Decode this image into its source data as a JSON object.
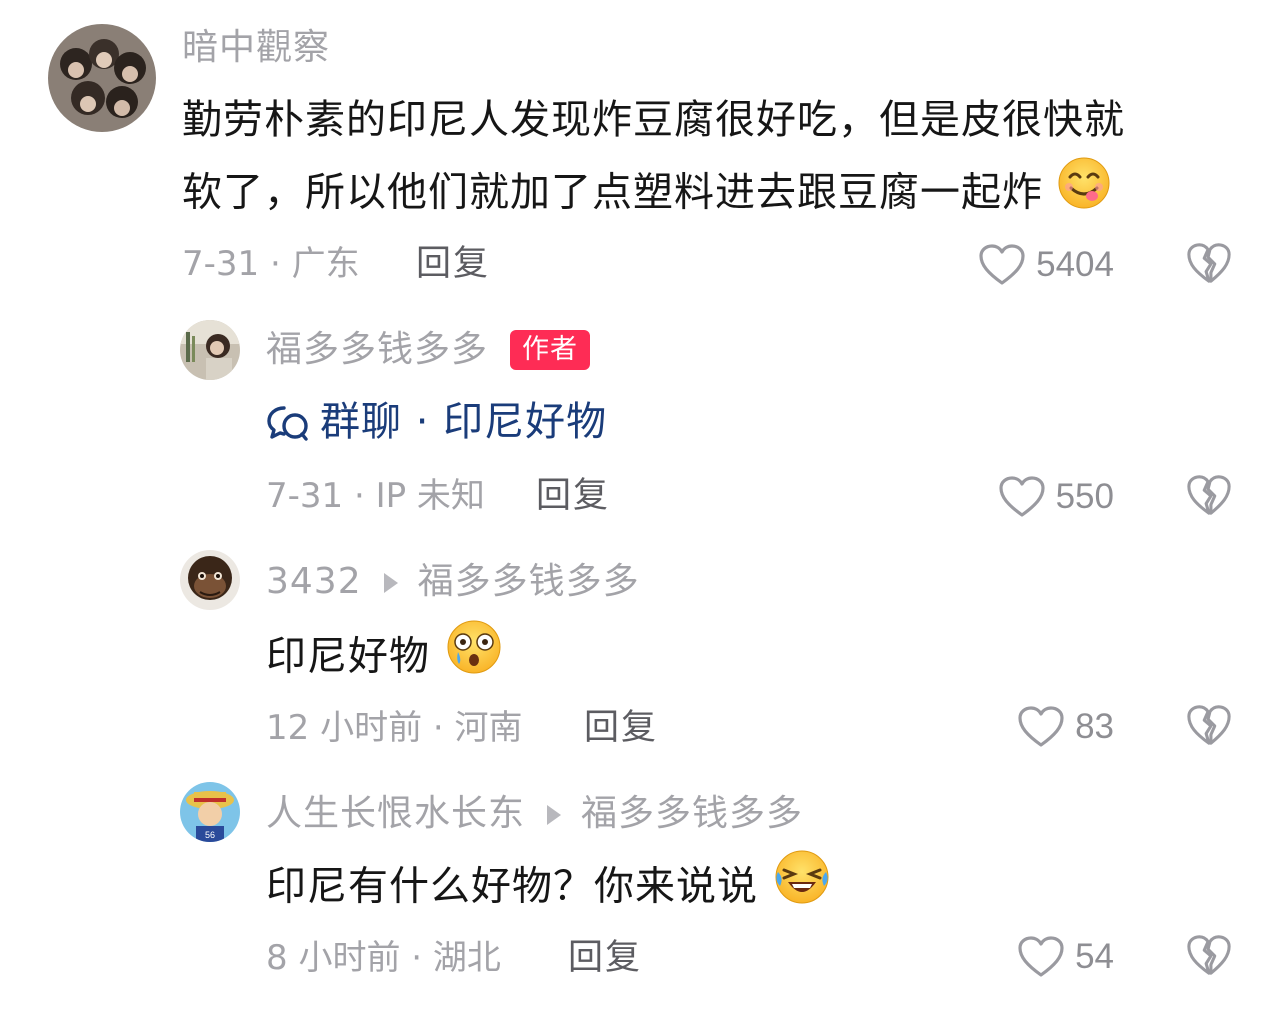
{
  "comments": [
    {
      "username": "暗中觀察",
      "text_line1": "勤劳朴素的印尼人发现炸豆腐很好吃，但是皮很快就",
      "text_line2": "软了，所以他们就加了点塑料进去跟豆腐一起炸",
      "emoji": "yum-face",
      "date_location": "7-31 · 广东",
      "reply_label": "回复",
      "likes": "5404"
    },
    {
      "username": "福多多钱多多",
      "badge": "作者",
      "group_link_text": "群聊 · 印尼好物",
      "group_icon": "chat-bubbles-icon",
      "date_location": "7-31 · IP 未知",
      "reply_label": "回复",
      "likes": "550"
    },
    {
      "username": "3432",
      "reply_to": "福多多钱多多",
      "text": "印尼好物",
      "emoji": "astonished-teary-face",
      "date_location": "12 小时前 · 河南",
      "reply_label": "回复",
      "likes": "83"
    },
    {
      "username": "人生长恨水长东",
      "reply_to": "福多多钱多多",
      "text": "印尼有什么好物？你来说说",
      "emoji": "rolling-laughing-face",
      "date_location": "8 小时前 · 湖北",
      "reply_label": "回复",
      "likes": "54"
    }
  ],
  "colors": {
    "meta_gray": "#a3a3a8",
    "badge_red": "#fe2c55",
    "link_blue": "#1a3c7a"
  }
}
